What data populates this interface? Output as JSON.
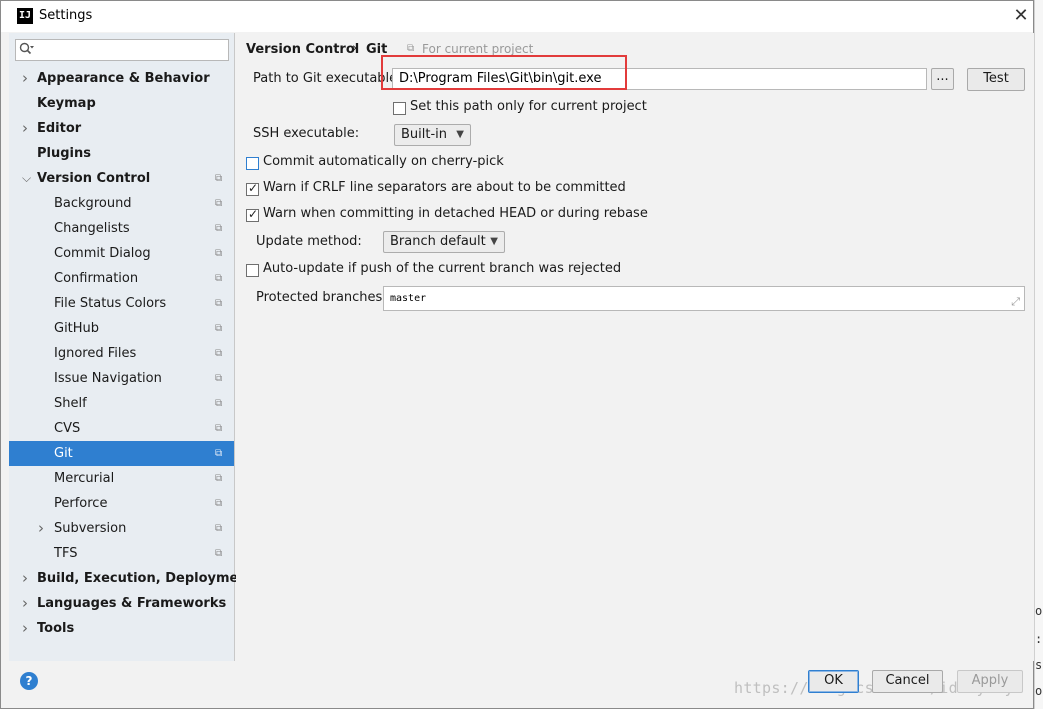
{
  "window": {
    "title": "Settings",
    "logo_text": "IJ",
    "close_glyph": "✕"
  },
  "sidebar": {
    "search_placeholder": "",
    "items": [
      {
        "label": "Appearance & Behavior",
        "bold": true,
        "expandable": true,
        "expanded": false
      },
      {
        "label": "Keymap",
        "bold": true
      },
      {
        "label": "Editor",
        "bold": true,
        "expandable": true,
        "expanded": false
      },
      {
        "label": "Plugins",
        "bold": true
      },
      {
        "label": "Version Control",
        "bold": true,
        "expandable": true,
        "expanded": true,
        "project": true
      },
      {
        "label": "Background",
        "project": true
      },
      {
        "label": "Changelists",
        "project": true
      },
      {
        "label": "Commit Dialog",
        "project": true
      },
      {
        "label": "Confirmation",
        "project": true
      },
      {
        "label": "File Status Colors",
        "project": true
      },
      {
        "label": "GitHub",
        "project": true
      },
      {
        "label": "Ignored Files",
        "project": true
      },
      {
        "label": "Issue Navigation",
        "project": true
      },
      {
        "label": "Shelf",
        "project": true
      },
      {
        "label": "CVS",
        "project": true
      },
      {
        "label": "Git",
        "project": true,
        "selected": true
      },
      {
        "label": "Mercurial",
        "project": true
      },
      {
        "label": "Perforce",
        "project": true
      },
      {
        "label": "Subversion",
        "project": true,
        "expandable": true
      },
      {
        "label": "TFS",
        "project": true
      },
      {
        "label": "Build, Execution, Deployment",
        "bold": true,
        "expandable": true
      },
      {
        "label": "Languages & Frameworks",
        "bold": true,
        "expandable": true
      },
      {
        "label": "Tools",
        "bold": true,
        "expandable": true
      }
    ]
  },
  "breadcrumb": {
    "parent": "Version Control",
    "separator": "›",
    "current": "Git",
    "scope": "For current project"
  },
  "git": {
    "path_label": "Path to Git executable:",
    "path_value": "D:\\Program Files\\Git\\bin\\git.exe",
    "browse_label": "...",
    "test_label": "Test",
    "current_project_only_label": "Set this path only for current project",
    "current_project_only_checked": false,
    "ssh_label": "SSH executable:",
    "ssh_value": "Built-in",
    "commit_cherry_pick_label": "Commit automatically on cherry-pick",
    "commit_cherry_pick_checked": false,
    "warn_crlf_label": "Warn if CRLF line separators are about to be committed",
    "warn_crlf_checked": true,
    "warn_detached_label": "Warn when committing in detached HEAD or during rebase",
    "warn_detached_checked": true,
    "update_method_label": "Update method:",
    "update_method_value": "Branch default",
    "auto_update_label": "Auto-update if push of the current branch was rejected",
    "auto_update_checked": false,
    "protected_label": "Protected branches:",
    "protected_value": "master"
  },
  "footer": {
    "help_glyph": "?",
    "ok_label": "OK",
    "cancel_label": "Cancel",
    "apply_label": "Apply",
    "watermark": "https://blog.csdn.net/idomyway"
  },
  "colors": {
    "accent": "#2f7fd0",
    "highlight_box": "#e23b3b",
    "sidebar_bg": "#e8edf2",
    "panel_bg": "#f2f2f2"
  }
}
